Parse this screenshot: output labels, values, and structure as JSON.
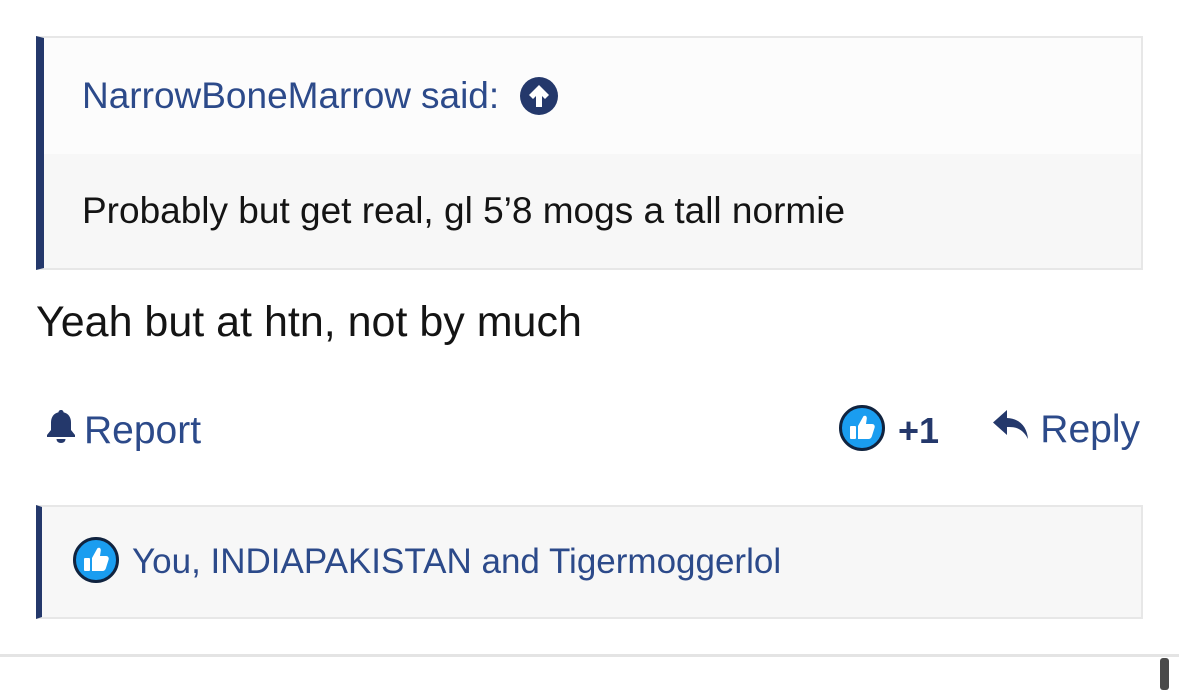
{
  "quote": {
    "author": "NarrowBoneMarrow",
    "said_label": "said:",
    "jump_icon": "arrow-up-circle-icon",
    "text": "Probably but get real, gl 5’8 mogs a tall normie"
  },
  "post": {
    "text": "Yeah but at htn, not by much"
  },
  "actions": {
    "report_label": "Report",
    "report_icon": "bell-icon",
    "like_icon": "thumbs-up-icon",
    "like_count": "+1",
    "reply_label": "Reply",
    "reply_icon": "reply-arrow-icon"
  },
  "reactions": {
    "icon": "thumbs-up-icon",
    "text": "You, INDIAPAKISTAN and Tigermoggerlol"
  },
  "colors": {
    "accent": "#24386b",
    "link": "#2c4a8a",
    "like_blue": "#1a9df0",
    "quote_bg": "#f7f7f7"
  }
}
